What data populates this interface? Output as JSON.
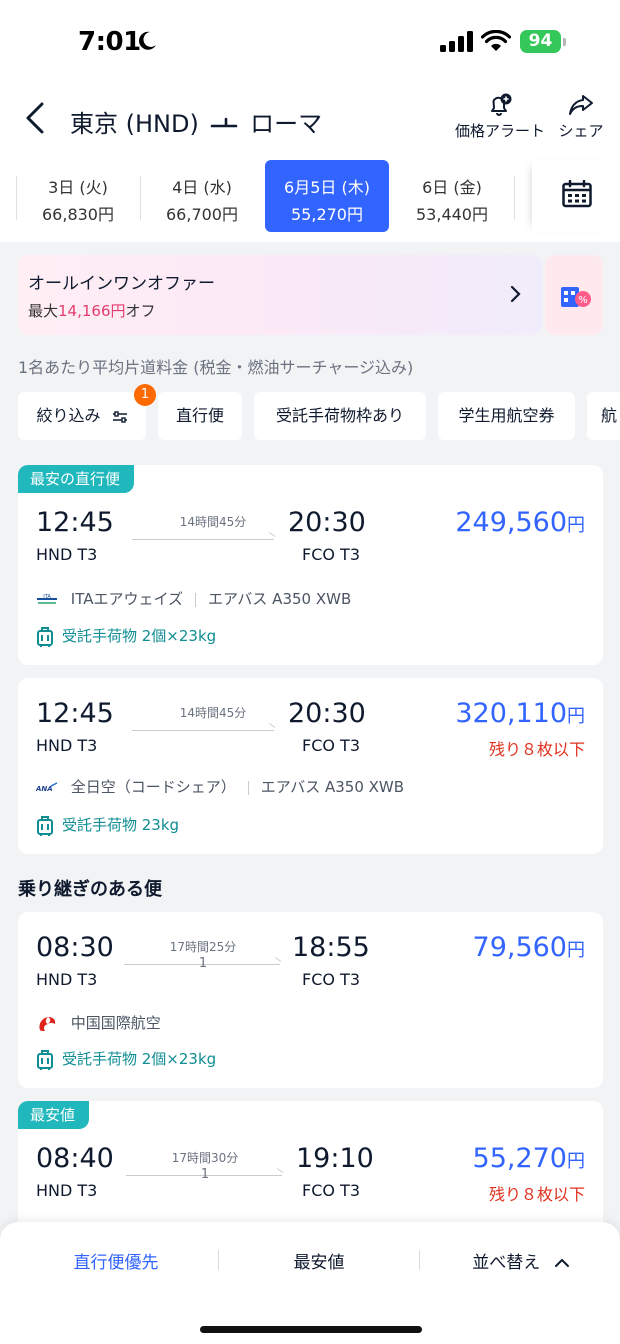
{
  "status_bar": {
    "time": "7:01",
    "battery": "94"
  },
  "header": {
    "route_from": "東京 (HND)",
    "route_to": "ローマ",
    "price_alert_label": "価格アラート",
    "share_label": "シェア"
  },
  "dates": [
    {
      "day": "3日 (火)",
      "price": "66,830円",
      "selected": false
    },
    {
      "day": "4日 (水)",
      "price": "66,700円",
      "selected": false
    },
    {
      "day": "6月5日 (木)",
      "price": "55,270円",
      "selected": true
    },
    {
      "day": "6日 (金)",
      "price": "53,440円",
      "selected": false
    }
  ],
  "promo": {
    "title": "オールインワンオファー",
    "prefix": "最大",
    "amount": "14,166円",
    "suffix": "オフ"
  },
  "fare_note": "1名あたり平均片道料金 (税金・燃油サーチャージ込み)",
  "filters": {
    "items": [
      "絞り込み",
      "直行便",
      "受託手荷物枠あり",
      "学生用航空券",
      "航"
    ],
    "badge_count": "1"
  },
  "flights": [
    {
      "tag": "最安の直行便",
      "dep_time": "12:45",
      "dep_code": "HND T3",
      "arr_time": "20:30",
      "arr_code": "FCO T3",
      "duration": "14時間45分",
      "stops": "",
      "price": "249,560",
      "currency": "円",
      "seats": "",
      "airline": "ITAエアウェイズ",
      "aircraft": "エアバス A350 XWB",
      "baggage": "受託手荷物 2個×23kg"
    },
    {
      "tag": "",
      "dep_time": "12:45",
      "dep_code": "HND T3",
      "arr_time": "20:30",
      "arr_code": "FCO T3",
      "duration": "14時間45分",
      "stops": "",
      "price": "320,110",
      "currency": "円",
      "seats": "残り８枚以下",
      "airline": "全日空（コードシェア）",
      "aircraft": "エアバス A350 XWB",
      "baggage": "受託手荷物 23kg"
    },
    {
      "tag": "",
      "dep_time": "08:30",
      "dep_code": "HND T3",
      "arr_time": "18:55",
      "arr_code": "FCO T3",
      "duration": "17時間25分",
      "stops": "1",
      "price": "79,560",
      "currency": "円",
      "seats": "",
      "airline": "中国国際航空",
      "aircraft": "",
      "baggage": "受託手荷物 2個×23kg"
    },
    {
      "tag": "最安値",
      "dep_time": "08:40",
      "dep_code": "HND T3",
      "arr_time": "19:10",
      "arr_code": "FCO T3",
      "duration": "17時間30分",
      "stops": "1",
      "price": "55,270",
      "currency": "円",
      "seats": "残り８枚以下",
      "airline": "",
      "aircraft": "",
      "baggage": ""
    }
  ],
  "section_connecting": "乗り継ぎのある便",
  "sort_bar": {
    "nonstop_first": "直行便優先",
    "cheapest": "最安値",
    "sort": "並べ替え"
  },
  "colors": {
    "accent": "#3264ff",
    "tag": "#20b7bd",
    "warning": "#e0311e",
    "baggage": "#0f8d93",
    "promo_amount": "#e63b6f"
  },
  "icons": [
    "moon-icon",
    "signal-icon",
    "wifi-icon",
    "back-icon",
    "bell-plus-icon",
    "share-icon",
    "calendar-icon",
    "chevron-right-icon",
    "filter-icon",
    "luggage-icon",
    "ita-logo-icon",
    "ana-logo-icon",
    "air-china-logo-icon",
    "chevron-up-icon"
  ]
}
